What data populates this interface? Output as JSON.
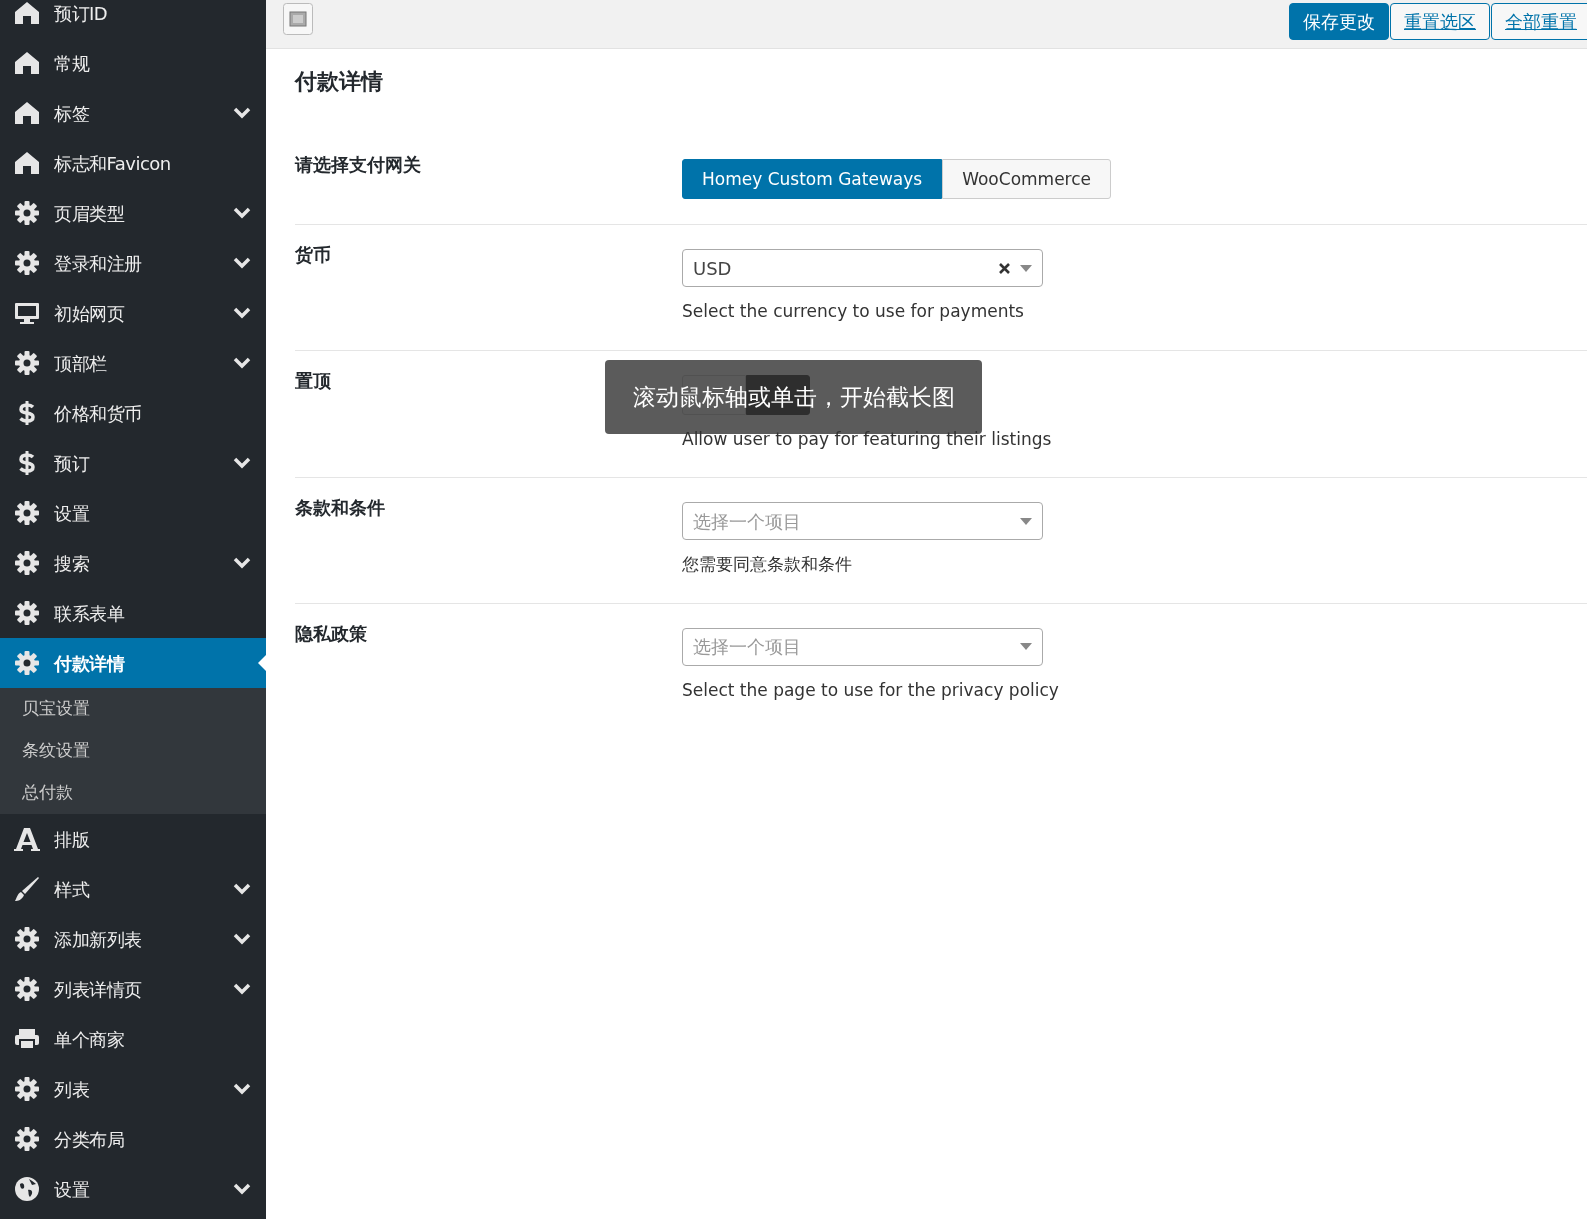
{
  "sidebar": {
    "items": [
      {
        "label": "预订ID",
        "kind": "home",
        "expandable": false,
        "selected": false
      },
      {
        "label": "常规",
        "kind": "home",
        "expandable": false,
        "selected": false
      },
      {
        "label": "标签",
        "kind": "home",
        "expandable": true,
        "selected": false
      },
      {
        "label": "标志和Favicon",
        "kind": "home",
        "expandable": false,
        "selected": false
      },
      {
        "label": "页眉类型",
        "kind": "gear",
        "expandable": true,
        "selected": false
      },
      {
        "label": "登录和注册",
        "kind": "gear",
        "expandable": true,
        "selected": false
      },
      {
        "label": "初始网页",
        "kind": "monitor",
        "expandable": true,
        "selected": false
      },
      {
        "label": "顶部栏",
        "kind": "gear",
        "expandable": true,
        "selected": false
      },
      {
        "label": "价格和货币",
        "kind": "dollar",
        "expandable": false,
        "selected": false
      },
      {
        "label": "预订",
        "kind": "dollar",
        "expandable": true,
        "selected": false
      },
      {
        "label": "设置",
        "kind": "gear",
        "expandable": false,
        "selected": false
      },
      {
        "label": "搜索",
        "kind": "gear",
        "expandable": true,
        "selected": false
      },
      {
        "label": "联系表单",
        "kind": "gear",
        "expandable": false,
        "selected": false
      },
      {
        "label": "付款详情",
        "kind": "gear",
        "expandable": false,
        "selected": true,
        "children": [
          {
            "label": "贝宝设置"
          },
          {
            "label": "条纹设置"
          },
          {
            "label": "总付款"
          }
        ]
      },
      {
        "label": "排版",
        "kind": "font",
        "expandable": false,
        "selected": false
      },
      {
        "label": "样式",
        "kind": "brush",
        "expandable": true,
        "selected": false
      },
      {
        "label": "添加新列表",
        "kind": "gear",
        "expandable": true,
        "selected": false
      },
      {
        "label": "列表详情页",
        "kind": "gear",
        "expandable": true,
        "selected": false
      },
      {
        "label": "单个商家",
        "kind": "printer",
        "expandable": false,
        "selected": false
      },
      {
        "label": "列表",
        "kind": "gear",
        "expandable": true,
        "selected": false
      },
      {
        "label": "分类布局",
        "kind": "gear",
        "expandable": false,
        "selected": false
      },
      {
        "label": "设置",
        "kind": "globe",
        "expandable": true,
        "selected": false
      }
    ]
  },
  "toolbar": {
    "buttons": [
      {
        "label": "保存更改",
        "kind": "primary"
      },
      {
        "label": "重置选区",
        "kind": "link"
      },
      {
        "label": "全部重置",
        "kind": "link"
      }
    ]
  },
  "page": {
    "title": "付款详情",
    "fields": [
      {
        "label": "请选择支付网关",
        "kind": "segmented",
        "options": [
          {
            "label": "Homey Custom Gateways",
            "selected": true
          },
          {
            "label": "WooCommerce",
            "selected": false
          }
        ]
      },
      {
        "label": "货币",
        "kind": "select",
        "value": "USD",
        "clearable": true,
        "description": "Select the currency to use for payments"
      },
      {
        "label": "置顶",
        "kind": "segmented",
        "options": [
          {
            "selected": false
          },
          {
            "selected": true
          }
        ],
        "description": "Allow user to pay for featuring their listings"
      },
      {
        "label": "条款和条件",
        "kind": "select",
        "placeholder": "选择一个项目",
        "description": "您需要同意条款和条件"
      },
      {
        "label": "隐私政策",
        "kind": "select",
        "placeholder": "选择一个项目",
        "description": "Select the page to use for the privacy policy"
      }
    ]
  },
  "toast": {
    "text": "滚动鼠标轴或单击，开始截长图"
  }
}
